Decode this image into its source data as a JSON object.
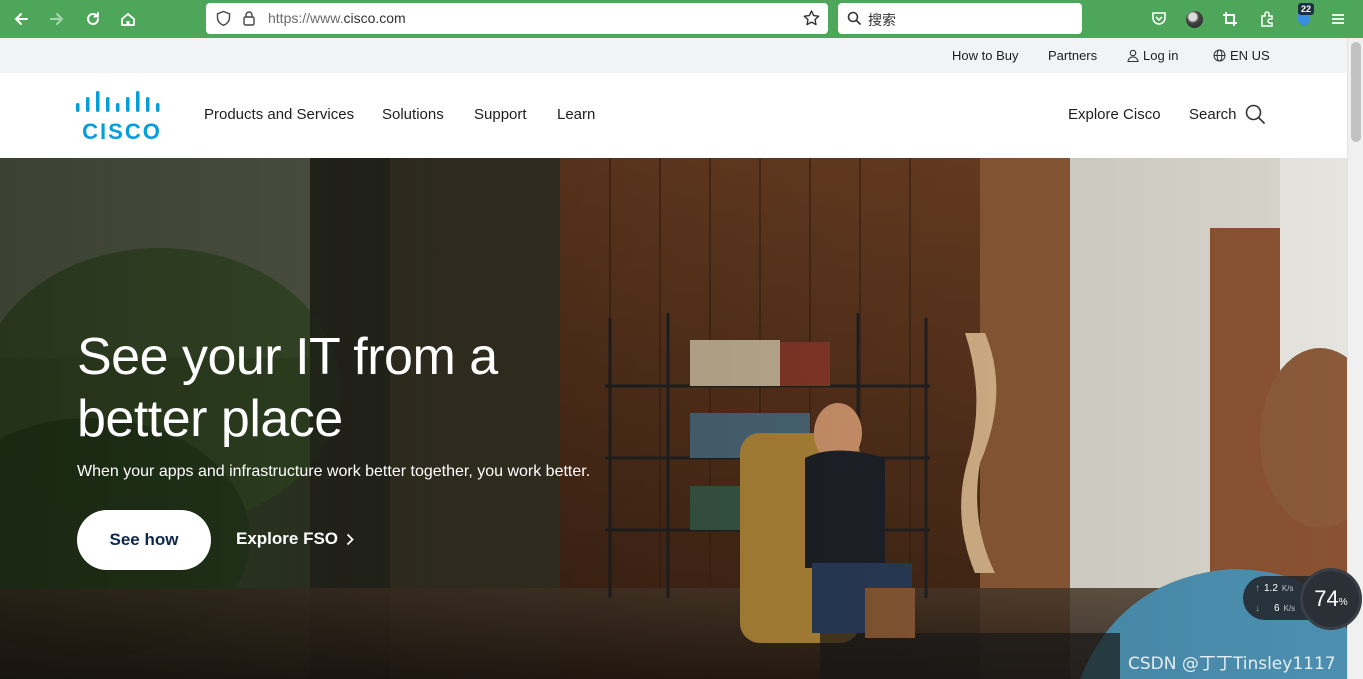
{
  "browser": {
    "url_prefix": "https://www.",
    "url_domain": "cisco.com",
    "search_placeholder": "搜索",
    "badge_count": "22"
  },
  "utility": {
    "how_to_buy": "How to Buy",
    "partners": "Partners",
    "login": "Log in",
    "language": "EN US"
  },
  "nav": {
    "logo_text": "CISCO",
    "items": [
      "Products and Services",
      "Solutions",
      "Support",
      "Learn"
    ],
    "explore": "Explore Cisco",
    "search": "Search"
  },
  "hero": {
    "title": "See your IT from a better place",
    "subtitle": "When your apps and infrastructure work better together, you work better.",
    "primary_cta": "See how",
    "secondary_cta": "Explore FSO"
  },
  "overlay": {
    "upload": "1.2",
    "upload_unit": "K/s",
    "download": "6",
    "download_unit": "K/s",
    "gauge_value": "74",
    "gauge_unit": "%",
    "watermark": "CSDN @丁丁Tinsley1117"
  },
  "colors": {
    "browser_green": "#4ea65a",
    "cisco_blue": "#049fd9",
    "cta_navy": "#0d274d"
  }
}
